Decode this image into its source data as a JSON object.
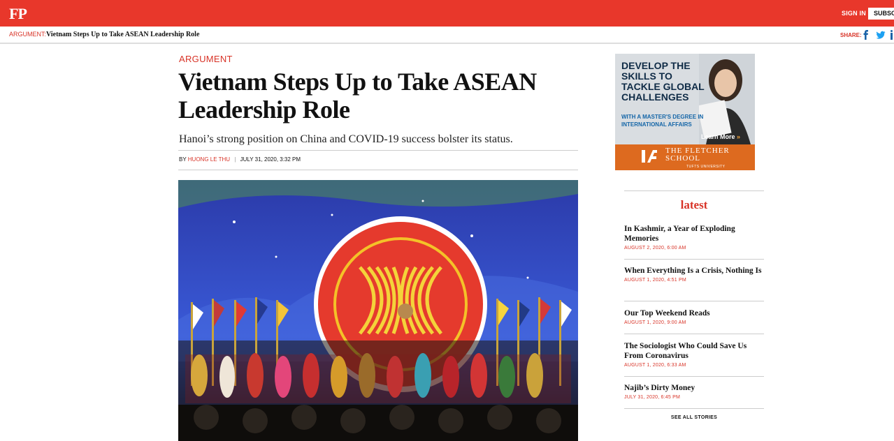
{
  "header": {
    "logo": "FP",
    "signin_label": "SIGN IN",
    "subscribe_label": "SUBSCRIBE"
  },
  "subbar": {
    "kicker": "ARGUMENT:",
    "title": "Vietnam Steps Up to Take ASEAN Leadership Role",
    "share_label": "SHARE:"
  },
  "article": {
    "kicker": "ARGUMENT",
    "headline": "Vietnam Steps Up to Take ASEAN Leadership Role",
    "dek": "Hanoi’s strong position on China and COVID-19 success bolster its status.",
    "by_label": "BY",
    "author": "HUONG LE THU",
    "date": "JULY 31, 2020, 3:32 PM"
  },
  "ad": {
    "headline": "DEVELOP THE SKILLS TO TACKLE GLOBAL CHALLENGES",
    "sub": "WITH A MASTER'S DEGREE IN INTERNATIONAL AFFAIRS",
    "cta": "Learn More",
    "school": "THE FLETCHER SCHOOL",
    "university": "TUFTS UNIVERSITY"
  },
  "latest": {
    "title": "latest",
    "stories": [
      {
        "title": "In Kashmir, a Year of Exploding Memories",
        "date": "AUGUST 2, 2020, 6:00 AM"
      },
      {
        "title": "When Everything Is a Crisis, Nothing Is",
        "date": "AUGUST 1, 2020, 4:51 PM"
      },
      {
        "title": "Our Top Weekend Reads",
        "date": "AUGUST 1, 2020, 9:00 AM"
      },
      {
        "title": "The Sociologist Who Could Save Us From Coronavirus",
        "date": "AUGUST 1, 2020, 6:33 AM"
      },
      {
        "title": "Najib’s Dirty Money",
        "date": "JULY 31, 2020, 6:45 PM"
      }
    ],
    "see_all": "SEE ALL STORIES"
  },
  "colors": {
    "brand_red": "#e8372b",
    "accent_red": "#d83327",
    "ad_orange": "#dd6a1f"
  }
}
